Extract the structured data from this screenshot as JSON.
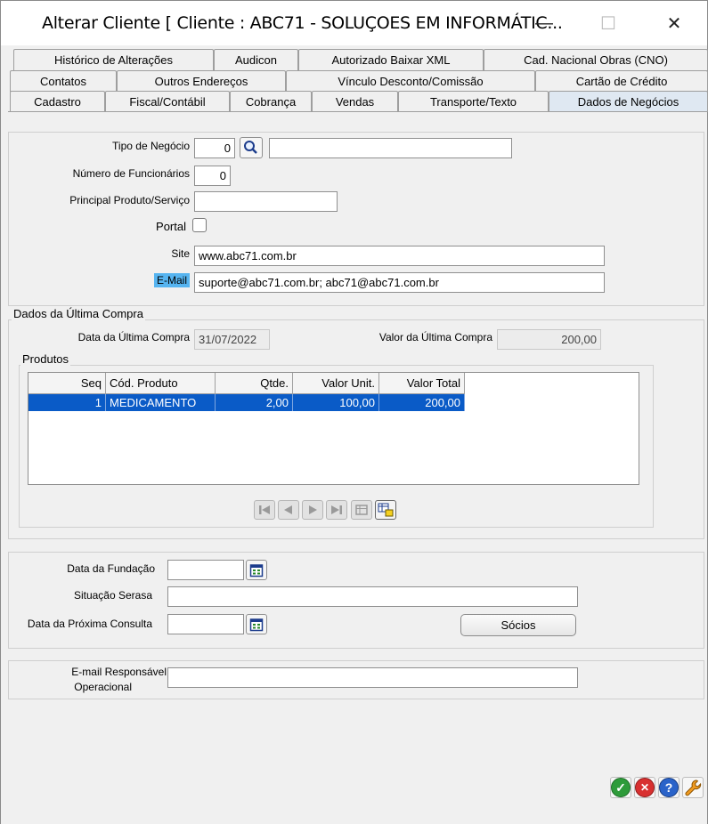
{
  "window": {
    "title": "Alterar Cliente [ Cliente : ABC71 - SOLUÇOES EM INFORMÁTIC...",
    "minimize_label": "—",
    "maximize_label": "☐",
    "close_label": "✕"
  },
  "tabs": {
    "row1": [
      "Histórico de Alterações",
      "Audicon",
      "Autorizado Baixar XML",
      "Cad. Nacional Obras (CNO)"
    ],
    "row2": [
      "Contatos",
      "Outros Endereços",
      "Vínculo Desconto/Comissão",
      "Cartão de Crédito"
    ],
    "row3": [
      "Cadastro",
      "Fiscal/Contábil",
      "Cobrança",
      "Vendas",
      "Transporte/Texto",
      "Dados de Negócios"
    ],
    "active": "Dados de Negócios"
  },
  "negocio": {
    "tipo_label": "Tipo de Negócio",
    "tipo_value": "0",
    "tipo_desc": "",
    "funcionarios_label": "Número de Funcionários",
    "funcionarios_value": "0",
    "produto_label": "Principal Produto/Serviço",
    "produto_value": "",
    "portal_label": "Portal",
    "site_label": "Site",
    "site_value": "www.abc71.com.br",
    "email_label": "E-Mail",
    "email_value": "suporte@abc71.com.br; abc71@abc71.com.br"
  },
  "ultima_compra": {
    "legend": "Dados da Última Compra",
    "data_label": "Data da Última Compra",
    "data_value": "31/07/2022",
    "valor_label": "Valor da Última Compra",
    "valor_value": "200,00",
    "produtos_legend": "Produtos",
    "columns": [
      "Seq",
      "Cód. Produto",
      "Qtde.",
      "Valor Unit.",
      "Valor Total"
    ],
    "rows": [
      {
        "seq": "1",
        "codigo": "MEDICAMENTO",
        "qtde": "2,00",
        "unit": "100,00",
        "total": "200,00"
      }
    ]
  },
  "fundacao": {
    "data_fundacao_label": "Data da Fundação",
    "data_fundacao_value": "",
    "serasa_label": "Situação Serasa",
    "serasa_value": "",
    "proxima_label": "Data da Próxima Consulta",
    "proxima_value": "",
    "socios_label": "Sócios"
  },
  "responsavel": {
    "label_line1": "E-mail Responsável",
    "label_line2": "Operacional",
    "value": ""
  },
  "footer": {
    "ok_symbol": "✓",
    "cancel_symbol": "✕",
    "help_symbol": "?",
    "tool_symbol": "🔧"
  }
}
